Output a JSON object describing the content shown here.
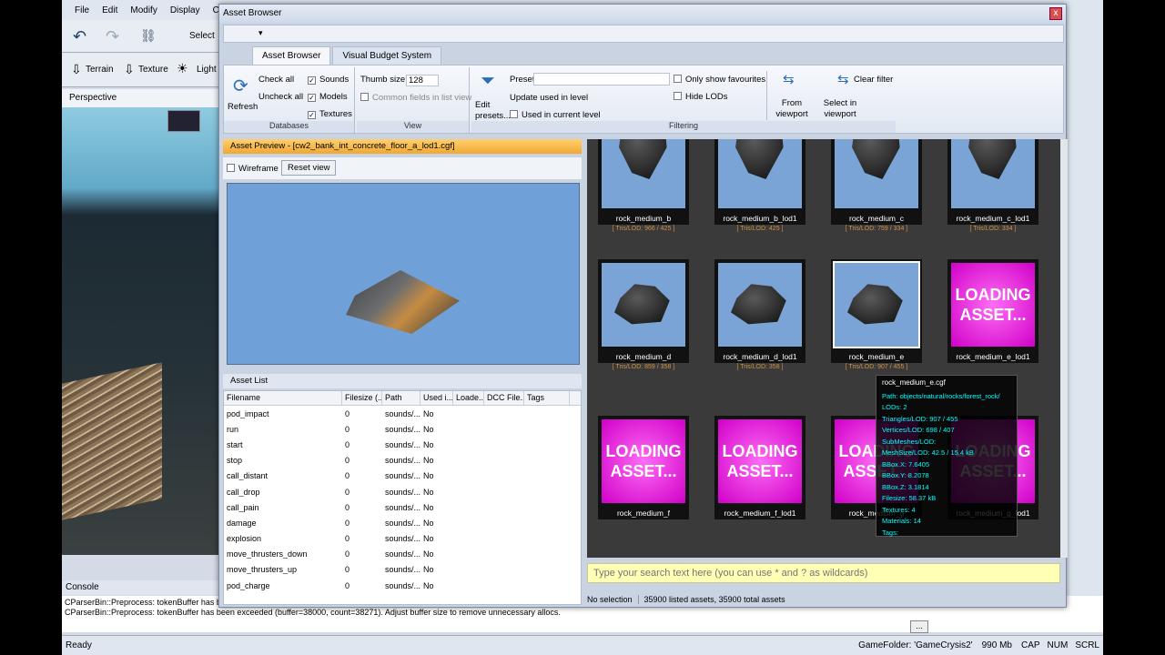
{
  "editor": {
    "menu": [
      "File",
      "Edit",
      "Modify",
      "Display",
      "Config"
    ],
    "toolbar1": {
      "select_label": "Select"
    },
    "toolbar2": {
      "terrain": "Terrain",
      "texture": "Texture",
      "lighting": "Light"
    },
    "viewport_title": "Perspective",
    "console_title": "Console",
    "console_lines": [
      "CParserBin::Preprocess: tokenBuffer has been e",
      "CParserBin::Preprocess: tokenBuffer has been exceeded (buffer=38000, count=38271). Adjust buffer size to remove unnecessary allocs."
    ],
    "status": {
      "ready": "Ready",
      "gamefolder": "GameFolder: 'GameCrysis2'",
      "memory": "990 Mb",
      "cap": "CAP",
      "num": "NUM",
      "scrl": "SCRL"
    },
    "more_button": "..."
  },
  "window": {
    "title": "Asset Browser",
    "close": "x",
    "tabs": [
      "Asset Browser",
      "Visual Budget System"
    ],
    "ribbon": {
      "databases": {
        "label": "Databases",
        "refresh": "Refresh",
        "check_all": "Check all",
        "uncheck_all": "Uncheck all",
        "sounds": "Sounds",
        "models": "Models",
        "textures": "Textures",
        "check": "✓"
      },
      "view": {
        "label": "View",
        "thumb_size_label": "Thumb size",
        "thumb_size_value": "128",
        "common_fields": "Common fields in list view"
      },
      "filtering": {
        "label": "Filtering",
        "edit_presets": "Edit presets...",
        "preset": "Preset:",
        "update_used": "Update used in level",
        "used_in_current": "Used in current level",
        "only_favourites": "Only show favourites",
        "hide_lods": "Hide LODs",
        "from_viewport": "From viewport selection",
        "select_in_viewport": "Select in viewport",
        "clear_filter": "Clear filter"
      }
    },
    "preview": {
      "title": "Asset Preview - [cw2_bank_int_concrete_floor_a_lod1.cgf]",
      "wireframe": "Wireframe",
      "reset_view": "Reset view"
    },
    "asset_list": {
      "title": "Asset List",
      "columns": [
        "Filename",
        "Filesize (...",
        "Path",
        "Used i...",
        "Loade...",
        "DCC File...",
        "Tags"
      ],
      "rows": [
        [
          "pod_impact",
          "0",
          "sounds/...",
          "No"
        ],
        [
          "run",
          "0",
          "sounds/...",
          "No"
        ],
        [
          "start",
          "0",
          "sounds/...",
          "No"
        ],
        [
          "stop",
          "0",
          "sounds/...",
          "No"
        ],
        [
          "call_distant",
          "0",
          "sounds/...",
          "No"
        ],
        [
          "call_drop",
          "0",
          "sounds/...",
          "No"
        ],
        [
          "call_pain",
          "0",
          "sounds/...",
          "No"
        ],
        [
          "damage",
          "0",
          "sounds/...",
          "No"
        ],
        [
          "explosion",
          "0",
          "sounds/...",
          "No"
        ],
        [
          "move_thrusters_down",
          "0",
          "sounds/...",
          "No"
        ],
        [
          "move_thrusters_up",
          "0",
          "sounds/...",
          "No"
        ],
        [
          "pod_charge",
          "0",
          "sounds/...",
          "No"
        ]
      ]
    },
    "thumbnails": [
      {
        "name": "rock_medium_b",
        "lod": "[ Tris/LOD: 966 / 425 ]",
        "kind": "top"
      },
      {
        "name": "rock_medium_b_lod1",
        "lod": "[ Tris/LOD: 425 ]",
        "kind": "top"
      },
      {
        "name": "rock_medium_c",
        "lod": "[ Tris/LOD: 759 / 334 ]",
        "kind": "top"
      },
      {
        "name": "rock_medium_c_lod1",
        "lod": "[ Tris/LOD: 334 ]",
        "kind": "top"
      },
      {
        "name": "rock_medium_d",
        "lod": "[ Tris/LOD: 859 / 358 ]",
        "kind": "rock"
      },
      {
        "name": "rock_medium_d_lod1",
        "lod": "[ Tris/LOD: 358 ]",
        "kind": "rock"
      },
      {
        "name": "rock_medium_e",
        "lod": "[ Tris/LOD: 907 / 455 ]",
        "kind": "rock-selected"
      },
      {
        "name": "rock_medium_e_lod1",
        "lod": "",
        "kind": "loading"
      },
      {
        "name": "rock_medium_f",
        "lod": "",
        "kind": "loading"
      },
      {
        "name": "rock_medium_f_lod1",
        "lod": "",
        "kind": "loading"
      },
      {
        "name": "rock_medium_g",
        "lod": "",
        "kind": "loading"
      },
      {
        "name": "rock_medium_g_lod1",
        "lod": "",
        "kind": "loading"
      }
    ],
    "loading_text": "LOADING ASSET...",
    "tooltip": {
      "title": "rock_medium_e.cgf",
      "lines": [
        "Path: objects/natural/rocks/forest_rock/",
        "LODs: 2",
        "Triangles/LOD: 907 / 455",
        "Vertices/LOD: 698 / 407",
        "SubMeshes/LOD:",
        "MeshSize/LOD: 42.5 / 15.4 kB",
        "BBox.X: 7.6405",
        "BBox.Y: 8.2078",
        "BBox.Z: 3.1814",
        "Filesize: 58.37 kB",
        "Textures: 4",
        "Materials: 14",
        "Tags:"
      ]
    },
    "search": {
      "placeholder": "Type your search text here (you can use * and ? as wildcards)"
    },
    "status": {
      "selection": "No selection",
      "counts": "35900 listed assets, 35900 total assets"
    }
  }
}
